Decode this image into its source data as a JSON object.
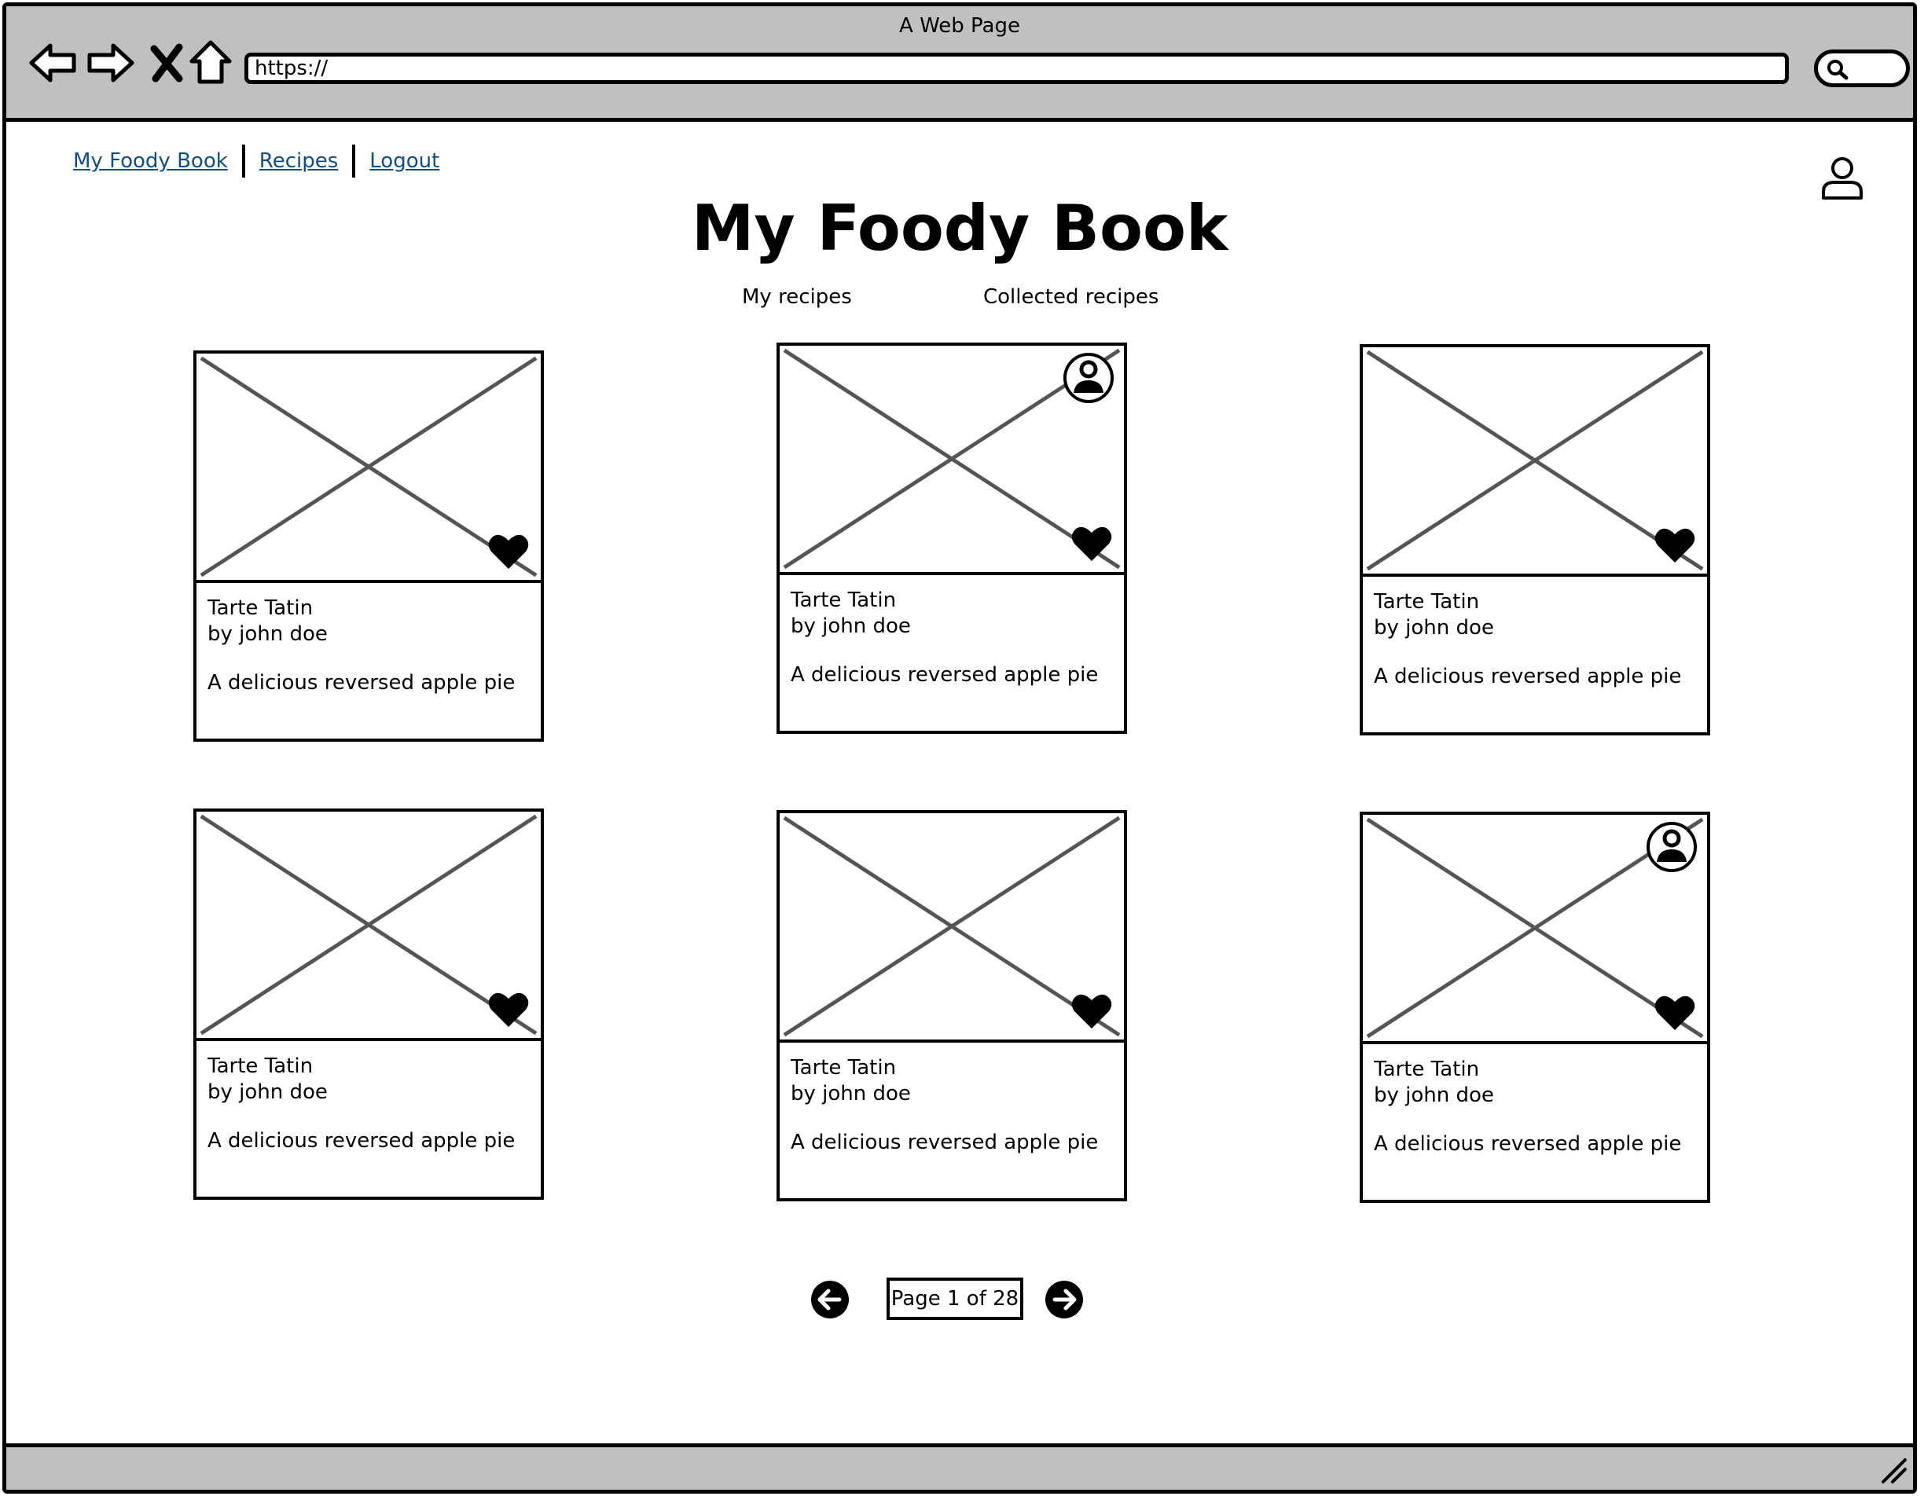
{
  "browser": {
    "window_title": "A Web Page",
    "url": "https://"
  },
  "nav": {
    "links": [
      "My Foody Book",
      "Recipes",
      "Logout"
    ]
  },
  "page": {
    "title": "My Foody Book",
    "tabs": [
      "My recipes",
      "Collected recipes"
    ]
  },
  "recipes": [
    {
      "title": "Tarte Tatin",
      "author": "by john doe",
      "description": "A delicious reversed apple pie",
      "favorited": true,
      "author_badge": false
    },
    {
      "title": "Tarte Tatin",
      "author": "by john doe",
      "description": "A delicious reversed apple pie",
      "favorited": true,
      "author_badge": true
    },
    {
      "title": "Tarte Tatin",
      "author": "by john doe",
      "description": "A delicious reversed apple pie",
      "favorited": true,
      "author_badge": false
    },
    {
      "title": "Tarte Tatin",
      "author": "by john doe",
      "description": "A delicious reversed apple pie",
      "favorited": true,
      "author_badge": false
    },
    {
      "title": "Tarte Tatin",
      "author": "by john doe",
      "description": "A delicious reversed apple pie",
      "favorited": true,
      "author_badge": false
    },
    {
      "title": "Tarte Tatin",
      "author": "by john doe",
      "description": "A delicious reversed apple pie",
      "favorited": true,
      "author_badge": true
    }
  ],
  "pagination": {
    "label": "Page 1 of 28",
    "prev_icon": "arrow-left-icon",
    "next_icon": "arrow-right-icon"
  },
  "icons": {
    "back": "back-arrow-icon",
    "forward": "forward-arrow-icon",
    "stop": "close-icon",
    "home": "home-icon",
    "search": "search-icon",
    "user": "user-icon",
    "favorite": "heart-icon",
    "author": "author-avatar-icon"
  }
}
